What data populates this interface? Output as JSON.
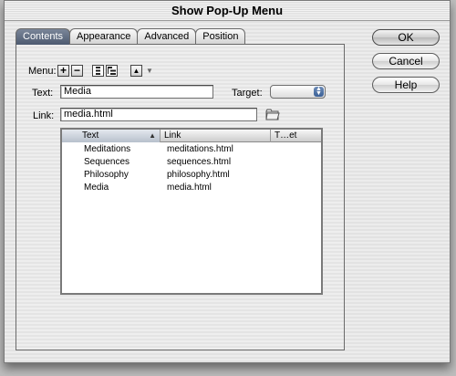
{
  "window": {
    "title": "Show Pop-Up Menu"
  },
  "tabs": [
    {
      "label": "Contents",
      "active": true
    },
    {
      "label": "Appearance",
      "active": false
    },
    {
      "label": "Advanced",
      "active": false
    },
    {
      "label": "Position",
      "active": false
    }
  ],
  "menu_toolbar": {
    "label": "Menu:",
    "add": "+",
    "remove": "−",
    "move_up": "▲",
    "move_down": "▼"
  },
  "text_field": {
    "label": "Text:",
    "value": "Media"
  },
  "target_field": {
    "label": "Target:",
    "value": ""
  },
  "link_field": {
    "label": "Link:",
    "value": "media.html"
  },
  "table": {
    "columns": [
      "Text",
      "Link",
      "T…et"
    ],
    "sort_indicator": "▲",
    "rows": [
      {
        "text": "Meditations",
        "link": "meditations.html",
        "target": ""
      },
      {
        "text": "Sequences",
        "link": "sequences.html",
        "target": ""
      },
      {
        "text": "Philosophy",
        "link": "philosophy.html",
        "target": ""
      },
      {
        "text": "Media",
        "link": "media.html",
        "target": ""
      }
    ]
  },
  "buttons": {
    "ok": "OK",
    "cancel": "Cancel",
    "help": "Help"
  },
  "icons": {
    "folder": "folder-icon",
    "indent": "indent-icon",
    "outdent": "outdent-icon",
    "popup_arrows": "popup-arrows-icon"
  }
}
